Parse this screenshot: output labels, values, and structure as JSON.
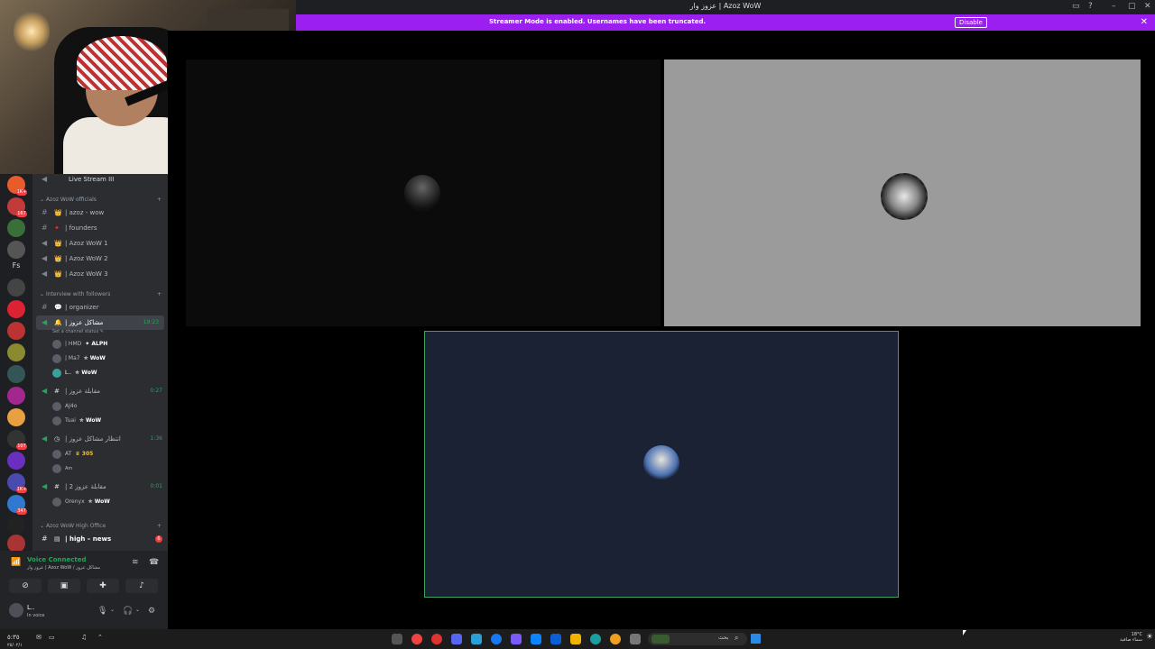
{
  "window": {
    "title": "عزوز وار | Azoz WoW",
    "controls": [
      "▭",
      "?",
      "–",
      "▢",
      "✕"
    ]
  },
  "streamer_banner": {
    "message": "Streamer Mode is enabled. Usernames have been truncated.",
    "disable_label": "Disable",
    "close": "✕"
  },
  "server_badges": [
    "1K+",
    "167",
    "",
    "",
    "",
    "Fs",
    "",
    "",
    "",
    "",
    "",
    "",
    "",
    "107",
    "",
    "1K+",
    "347",
    "671",
    ""
  ],
  "channels": {
    "live_stream": "Live Stream III",
    "cat_officials": "Azoz WoW officials",
    "cat_interview": "Interview with followers",
    "cat_high_office": "Azoz WoW High Office",
    "azoz_wow": "| azoz - wow",
    "founders": "| founders",
    "azoz1": "| Azoz WoW 1",
    "azoz2": "| Azoz WoW 2",
    "azoz3": "| Azoz WoW 3",
    "organizer": "| organizer",
    "mashakel": "| مشاكل عزوز",
    "mashakel_time": "19:23",
    "set_status": "Set a channel status ✎",
    "muqabala": "| مقابلة عزوز",
    "muqabala_time": "0:27",
    "intizar": "| انتظار مشاكل عزوز",
    "intizar_time": "1:36",
    "muqabala2": "| مقابلة عزوز 2",
    "muqabala2_time": "0:01",
    "high_news": "| high – news",
    "high_news_mentions": "6"
  },
  "voice_users": {
    "u1": "| HMD",
    "u1_tag": "✦ ALPH",
    "u2": "| Ma7",
    "u2_tag": "✯ WoW",
    "u3": "L..",
    "u3_tag": "✯ WoW",
    "u4": "AJ4o",
    "u5": "Tuai",
    "u5_tag": "✯ WoW",
    "u6": "AT",
    "u6_tag": "♛ 305",
    "u7": "Am",
    "u8": "Orenyx",
    "u8_tag": "✯ WoW"
  },
  "voice": {
    "status": "Voice Connected",
    "channel": "عزوز وار | Azoz WoW / مشاكل عزوز"
  },
  "user": {
    "name": "L..",
    "status": "In voice"
  },
  "taskbar": {
    "search_text": "بحث",
    "clock": "٥:٣٥",
    "date": "٢٥/٠٢/١",
    "weather_temp": "18°C",
    "weather_desc": "سماء صافية"
  }
}
